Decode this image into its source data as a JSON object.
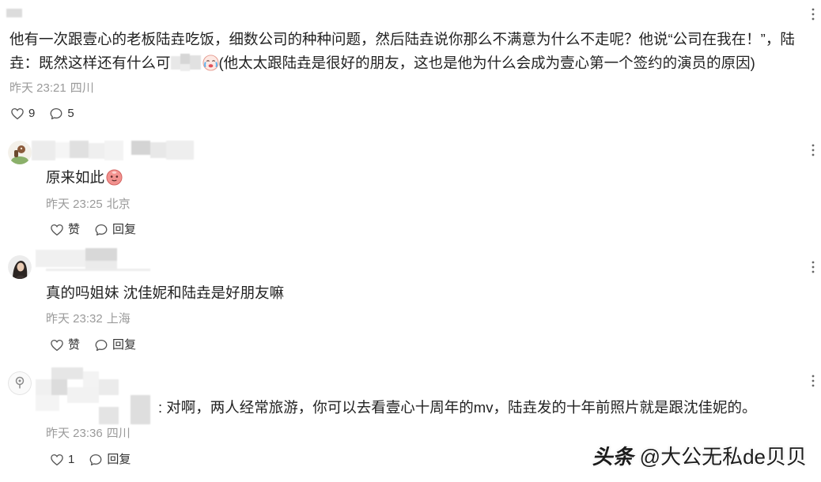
{
  "thread": {
    "top": {
      "more_icon": "more-vertical-icon"
    },
    "comment": {
      "text_before": "他有一次跟壹心的老板陆垚吃饭，细数公司的种种问题，然后陆垚说你那么不满意为什么不走呢？他说“公司在我在！”，陆垚：既然这样还有什么可",
      "emoji_icon": "crying-face-emoji-icon",
      "text_after": "(他太太跟陆垚是很好的朋友，这也是他为什么会成为壹心第一个签约的演员的原因)",
      "time": "昨天 23:21",
      "location": "四川",
      "like_icon": "heart-icon",
      "like_count": "9",
      "reply_icon": "comment-bubble-icon",
      "reply_count": "5"
    },
    "replies": [
      {
        "text": "原来如此",
        "emoji_icon": "pink-face-emoji-icon",
        "time": "昨天 23:25",
        "location": "北京",
        "like_label": "赞",
        "reply_label": "回复"
      },
      {
        "text": "真的吗姐妹 沈佳妮和陆垚是好朋友嘛",
        "time": "昨天 23:32",
        "location": "上海",
        "like_label": "赞",
        "reply_label": "回复"
      },
      {
        "text": ": 对啊，两人经常旅游，你可以去看壹心十周年的mv，陆垚发的十年前照片就是跟沈佳妮的。",
        "time": "昨天 23:36",
        "location": "四川",
        "like_label": "1",
        "reply_label": "回复"
      }
    ]
  },
  "watermark": {
    "platform": "头条",
    "handle": "@大公无私de贝贝"
  },
  "colors": {
    "background": "#ffffff",
    "text": "#222222",
    "meta": "#9a9a9a",
    "icon": "#555555"
  }
}
